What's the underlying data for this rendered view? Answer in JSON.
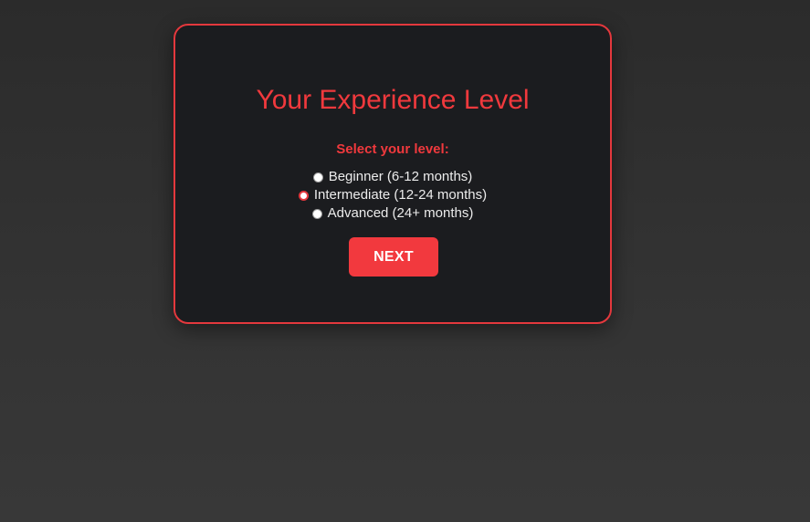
{
  "card": {
    "title": "Your Experience Level",
    "subtitle": "Select your level:",
    "options": [
      {
        "label": "Beginner (6-12 months)",
        "checked": false
      },
      {
        "label": "Intermediate (12-24 months)",
        "checked": true
      },
      {
        "label": "Advanced (24+ months)",
        "checked": false
      }
    ],
    "next_label": "NEXT"
  },
  "colors": {
    "accent": "#f0393d",
    "card_background": "#1b1c1f",
    "page_background": "#2f2f2f",
    "option_text": "#ececec",
    "button_text": "#ffffff"
  },
  "icons": {
    "radio_unchecked": "radio-unchecked-icon",
    "radio_checked": "radio-checked-icon"
  }
}
